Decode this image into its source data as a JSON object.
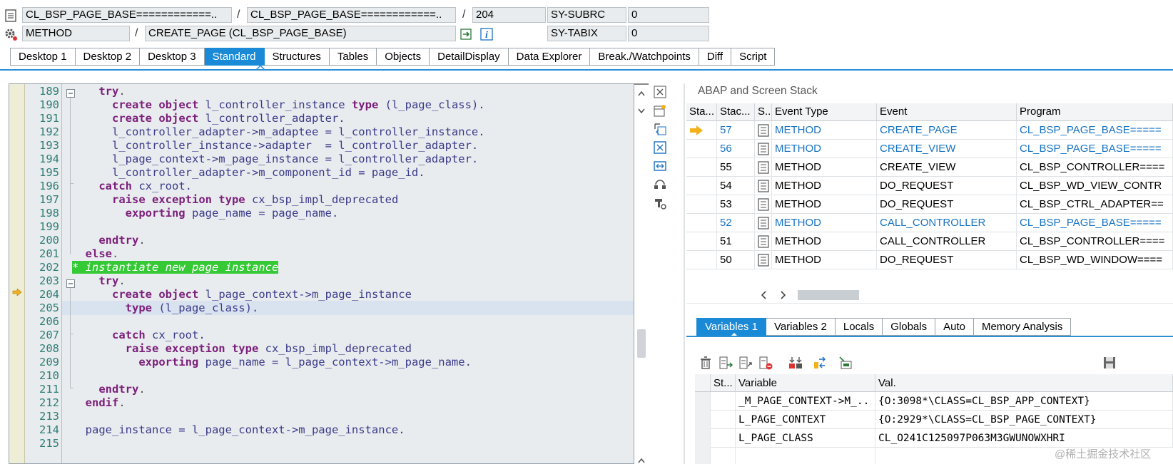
{
  "header": {
    "row1": {
      "program1": "CL_BSP_PAGE_BASE============..",
      "program2": "CL_BSP_PAGE_BASE============..",
      "line": "204",
      "sysfield1": "SY-SUBRC",
      "sysvalue1": "0"
    },
    "row2": {
      "type": "METHOD",
      "method": "CREATE_PAGE (CL_BSP_PAGE_BASE)",
      "sysfield2": "SY-TABIX",
      "sysvalue2": "0"
    },
    "separators": [
      "/",
      "/",
      "/"
    ]
  },
  "tabs": [
    {
      "label": "Desktop 1"
    },
    {
      "label": "Desktop 2"
    },
    {
      "label": "Desktop 3"
    },
    {
      "label": "Standard",
      "active": true
    },
    {
      "label": "Structures"
    },
    {
      "label": "Tables"
    },
    {
      "label": "Objects"
    },
    {
      "label": "DetailDisplay"
    },
    {
      "label": "Data Explorer"
    },
    {
      "label": "Break./Watchpoints"
    },
    {
      "label": "Diff"
    },
    {
      "label": "Script"
    }
  ],
  "code": {
    "lines": [
      {
        "no": "189",
        "tokens": [
          [
            "",
            "    "
          ],
          [
            "kw",
            "try"
          ],
          [
            "op",
            "."
          ]
        ]
      },
      {
        "no": "190",
        "tokens": [
          [
            "",
            "      "
          ],
          [
            "kw",
            "create object"
          ],
          [
            "",
            " l_controller_instance "
          ],
          [
            "kw",
            "type"
          ],
          [
            "",
            " (l_page_class)."
          ]
        ]
      },
      {
        "no": "191",
        "tokens": [
          [
            "",
            "      "
          ],
          [
            "kw",
            "create object"
          ],
          [
            "",
            " l_controller_adapter."
          ]
        ]
      },
      {
        "no": "192",
        "tokens": [
          [
            "",
            "      l_controller_adapter->m_adaptee = l_controller_instance."
          ]
        ]
      },
      {
        "no": "193",
        "tokens": [
          [
            "",
            "      l_controller_instance->adapter  = l_controller_adapter."
          ]
        ]
      },
      {
        "no": "194",
        "tokens": [
          [
            "",
            "      l_page_context->m_page_instance = l_controller_adapter."
          ]
        ]
      },
      {
        "no": "195",
        "tokens": [
          [
            "",
            "      l_controller_adapter->m_component_id = page_id."
          ]
        ]
      },
      {
        "no": "196",
        "tokens": [
          [
            "",
            "    "
          ],
          [
            "kw",
            "catch"
          ],
          [
            "",
            " cx_root."
          ]
        ]
      },
      {
        "no": "197",
        "tokens": [
          [
            "",
            "      "
          ],
          [
            "kw",
            "raise exception type"
          ],
          [
            "",
            " cx_bsp_impl_deprecated"
          ]
        ]
      },
      {
        "no": "198",
        "tokens": [
          [
            "",
            "        "
          ],
          [
            "kw",
            "exporting"
          ],
          [
            "",
            " page_name = page_name."
          ]
        ]
      },
      {
        "no": "199",
        "tokens": [
          [
            "",
            ""
          ]
        ]
      },
      {
        "no": "200",
        "tokens": [
          [
            "",
            "    "
          ],
          [
            "kw",
            "endtry"
          ],
          [
            "op",
            "."
          ]
        ]
      },
      {
        "no": "201",
        "tokens": [
          [
            "",
            "  "
          ],
          [
            "kw",
            "else"
          ],
          [
            "op",
            "."
          ]
        ]
      },
      {
        "no": "202",
        "tokens": [
          [
            "hl",
            "* instantiate new page instance"
          ]
        ]
      },
      {
        "no": "203",
        "tokens": [
          [
            "",
            "    "
          ],
          [
            "kw",
            "try"
          ],
          [
            "op",
            "."
          ]
        ]
      },
      {
        "no": "204",
        "tokens": [
          [
            "",
            "      "
          ],
          [
            "kw",
            "create object"
          ],
          [
            "",
            " l_page_context->m_page_instance"
          ]
        ]
      },
      {
        "no": "205",
        "tokens": [
          [
            "",
            "        "
          ],
          [
            "kw",
            "type"
          ],
          [
            "",
            " (l_page_class)."
          ]
        ],
        "current": true
      },
      {
        "no": "206",
        "tokens": [
          [
            "",
            ""
          ]
        ]
      },
      {
        "no": "207",
        "tokens": [
          [
            "",
            "      "
          ],
          [
            "kw",
            "catch"
          ],
          [
            "",
            " cx_root."
          ]
        ]
      },
      {
        "no": "208",
        "tokens": [
          [
            "",
            "        "
          ],
          [
            "kw",
            "raise exception type"
          ],
          [
            "",
            " cx_bsp_impl_deprecated"
          ]
        ]
      },
      {
        "no": "209",
        "tokens": [
          [
            "",
            "          "
          ],
          [
            "kw",
            "exporting"
          ],
          [
            "",
            " page_name = l_page_context->m_page_name."
          ]
        ]
      },
      {
        "no": "210",
        "tokens": [
          [
            "",
            ""
          ]
        ]
      },
      {
        "no": "211",
        "tokens": [
          [
            "",
            "    "
          ],
          [
            "kw",
            "endtry"
          ],
          [
            "op",
            "."
          ]
        ]
      },
      {
        "no": "212",
        "tokens": [
          [
            "",
            "  "
          ],
          [
            "kw",
            "endif"
          ],
          [
            "op",
            "."
          ]
        ]
      },
      {
        "no": "213",
        "tokens": [
          [
            "",
            ""
          ]
        ]
      },
      {
        "no": "214",
        "tokens": [
          [
            "",
            "  page_instance = l_page_context->m_page_instance."
          ]
        ]
      },
      {
        "no": "215",
        "tokens": [
          [
            "",
            ""
          ]
        ]
      }
    ]
  },
  "stack": {
    "title": "ABAP and Screen Stack",
    "columns": [
      "Sta...",
      "Stac...",
      "S..",
      "Event Type",
      "Event",
      "Program"
    ],
    "rows": [
      {
        "current": true,
        "level": "57",
        "event_type": "METHOD",
        "event": "CREATE_PAGE",
        "program": "CL_BSP_PAGE_BASE=====",
        "blue": true
      },
      {
        "level": "56",
        "event_type": "METHOD",
        "event": "CREATE_VIEW",
        "program": "CL_BSP_PAGE_BASE=====",
        "blue": true
      },
      {
        "level": "55",
        "event_type": "METHOD",
        "event": "CREATE_VIEW",
        "program": "CL_BSP_CONTROLLER====",
        "blue": false
      },
      {
        "level": "54",
        "event_type": "METHOD",
        "event": "DO_REQUEST",
        "program": "CL_BSP_WD_VIEW_CONTR",
        "blue": false
      },
      {
        "level": "53",
        "event_type": "METHOD",
        "event": "DO_REQUEST",
        "program": "CL_BSP_CTRL_ADAPTER==",
        "blue": false
      },
      {
        "level": "52",
        "event_type": "METHOD",
        "event": "CALL_CONTROLLER",
        "program": "CL_BSP_PAGE_BASE=====",
        "blue": true
      },
      {
        "level": "51",
        "event_type": "METHOD",
        "event": "CALL_CONTROLLER",
        "program": "CL_BSP_CONTROLLER====",
        "blue": false
      },
      {
        "level": "50",
        "event_type": "METHOD",
        "event": "DO_REQUEST",
        "program": "CL_BSP_WD_WINDOW====",
        "blue": false
      }
    ]
  },
  "var_tabs": [
    {
      "label": "Variables 1",
      "active": true
    },
    {
      "label": "Variables 2"
    },
    {
      "label": "Locals"
    },
    {
      "label": "Globals"
    },
    {
      "label": "Auto"
    },
    {
      "label": "Memory Analysis"
    }
  ],
  "variables": {
    "columns": [
      "St...",
      "Variable",
      "Val."
    ],
    "rows": [
      {
        "name": "_M_PAGE_CONTEXT->M_..",
        "value": "{O:3098*\\CLASS=CL_BSP_APP_CONTEXT}"
      },
      {
        "name": "L_PAGE_CONTEXT",
        "value": "{O:2929*\\CLASS=CL_BSP_PAGE_CONTEXT}"
      },
      {
        "name": "L_PAGE_CLASS",
        "value": "CL_O241C125097P063M3GWUNOWXHRI"
      }
    ]
  },
  "watermark": "@稀土掘金技术社区",
  "colors": {
    "accent": "#1a8ad6",
    "keyword": "#7b1f7a",
    "highlight": "#35c935",
    "blue_link": "#1773c2"
  }
}
